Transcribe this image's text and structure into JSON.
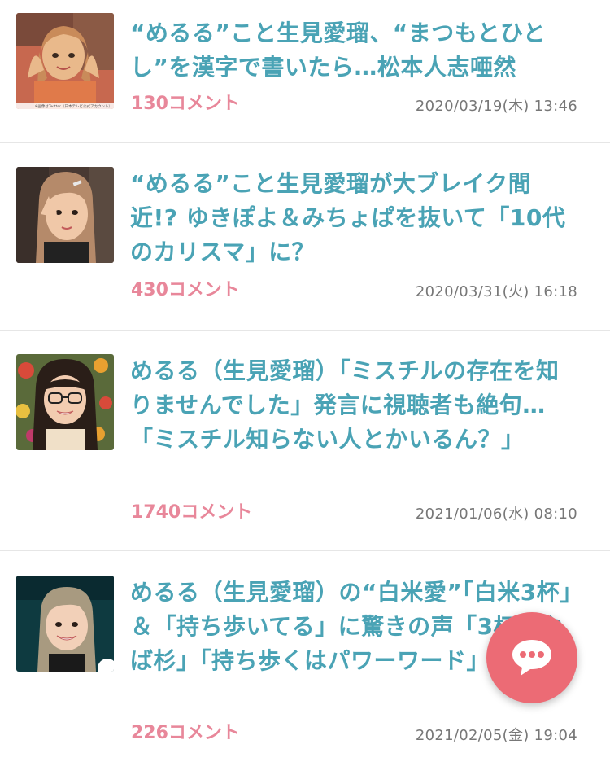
{
  "articles": [
    {
      "title": "“めるる”こと生見愛瑠、“まつもとひとし”を漢字で書いたら…松本人志唖然",
      "comments": "130コメント",
      "date": "2020/03/19(木) 13:46",
      "image_credit": "※画像はTwitter（日本テレビ公式アカウント）"
    },
    {
      "title": "“めるる”こと生見愛瑠が大ブレイク間近!? ゆきぽよ＆みちょぱを抜いて「10代のカリスマ」に？",
      "comments": "430コメント",
      "date": "2020/03/31(火) 16:18"
    },
    {
      "title": "めるる（生見愛瑠）「ミスチルの存在を知りませんでした」発言に視聴者も絶句…「ミスチル知らない人とかいるん？」",
      "comments": "1740コメント",
      "date": "2021/01/06(水) 08:10"
    },
    {
      "title": "めるる（生見愛瑠）の“白米愛”「白米3杯」＆「持ち歩いてる」に驚きの声「3杯はやば杉」「持ち歩くはパワーワード」",
      "comments": "226コメント",
      "date": "2021/02/05(金) 19:04"
    }
  ],
  "chat_button": {
    "icon": "chat-bubble-icon",
    "color": "#ec6b75"
  }
}
